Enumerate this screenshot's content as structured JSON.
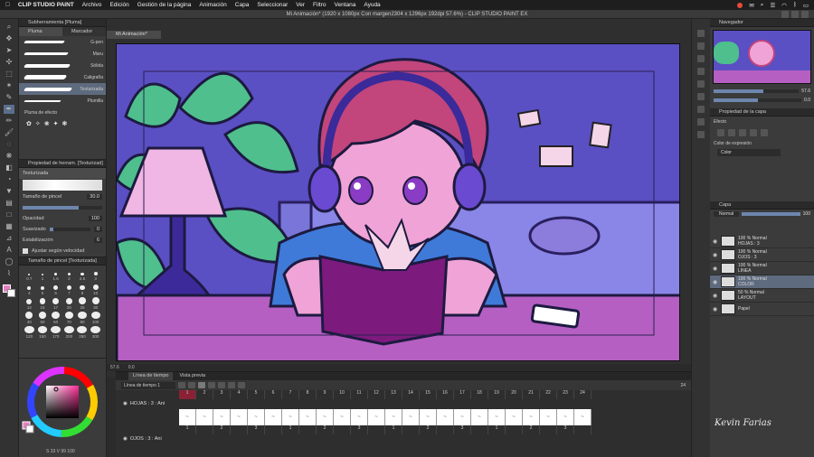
{
  "menubar": {
    "app": "CLIP STUDIO PAINT",
    "items": [
      "Archivo",
      "Edición",
      "Gestión de la página",
      "Animación",
      "Capa",
      "Seleccionar",
      "Ver",
      "Filtro",
      "Ventana",
      "Ayuda"
    ]
  },
  "window": {
    "title": "Mi Animación* (1920 x 1080px Con margen2304 x 1296px 192dpi 57.6%) - CLIP STUDIO PAINT EX",
    "doc_tab": "Mi Animación*"
  },
  "subtool": {
    "panel_title": "Subherramienta [Pluma]",
    "tabs": [
      "Pluma",
      "Marcador"
    ],
    "brushes": [
      {
        "label": "G-pen"
      },
      {
        "label": "Maru"
      },
      {
        "label": "Sólida"
      },
      {
        "label": "Caligrafía"
      },
      {
        "label": "Texturizada"
      },
      {
        "label": "Plumilla"
      }
    ],
    "extra_label": "Pluma de efecto"
  },
  "tool_property": {
    "panel_title": "Propiedad de herram. [Texturizad]",
    "tool_name": "Texturizada",
    "brush_size_label": "Tamaño de pincel",
    "brush_size_value": "30.0",
    "opacity_label": "Opacidad",
    "opacity_value": "100",
    "smoothing_label": "Suavizado",
    "smoothing_value": "0",
    "stabilization_label": "Estabilización",
    "stabilization_value": "6",
    "speed_label": "Ajustar según velocidad"
  },
  "brush_size_panel": {
    "title": "Tamaño de pincel [Texturizada]",
    "sizes": [
      "0.7",
      "1",
      "1.5",
      "2",
      "2.5",
      "3",
      "4",
      "5",
      "6",
      "7",
      "8",
      "10",
      "12",
      "15",
      "17",
      "20",
      "25",
      "30",
      "40",
      "50",
      "60",
      "70",
      "80",
      "100",
      "120",
      "150",
      "170",
      "200",
      "250",
      "300"
    ]
  },
  "color_panel": {
    "hsv_readout": "S 33 V 99 100",
    "main_color": "#e77fc2",
    "sub_color": "#ffffff"
  },
  "canvas_status": {
    "zoom": "57.6",
    "rotation": "0.0"
  },
  "timeline": {
    "tabs": [
      "Línea de tiempo",
      "Vista previa"
    ],
    "timeline_select": "Línea de tiempo 1",
    "frame_numbers": [
      "1",
      "2",
      "3",
      "4",
      "5",
      "6",
      "7",
      "8",
      "9",
      "10",
      "11",
      "12",
      "13",
      "14",
      "15",
      "16",
      "17",
      "18",
      "19",
      "20",
      "21",
      "22",
      "23",
      "24"
    ],
    "end_frame": "24",
    "tracks": [
      {
        "label": "HOJAS : 3 : Ani",
        "cells": [
          "1",
          "",
          "2",
          "",
          "3",
          "",
          "1",
          "",
          "2",
          "",
          "3",
          "",
          "1",
          "",
          "2",
          "",
          "3",
          "",
          "1",
          "",
          "2",
          "",
          "3",
          ""
        ]
      },
      {
        "label": "OJOS : 3 : Ani",
        "cells": []
      }
    ]
  },
  "navigator": {
    "title": "Navegador",
    "zoom": "57.6",
    "angle": "0.0"
  },
  "layer_property": {
    "title": "Propiedad de la capa",
    "effect_label": "Efecto",
    "expression_label": "Color de expresión",
    "expression_value": "Color"
  },
  "layers": {
    "title": "Capa",
    "blend_mode": "Normal",
    "opacity": "100",
    "items": [
      {
        "mode": "100 % Normal",
        "name": "HOJAS : 3",
        "selected": false
      },
      {
        "mode": "100 % Normal",
        "name": "OJOS : 3",
        "selected": false
      },
      {
        "mode": "100 % Normal",
        "name": "LINEA",
        "selected": false
      },
      {
        "mode": "100 % Normal",
        "name": "COLOR",
        "selected": true
      },
      {
        "mode": "50 % Normal",
        "name": "LAYOUT",
        "selected": false
      },
      {
        "mode": "",
        "name": "Papel",
        "selected": false
      }
    ]
  },
  "watermark": "Kevin Farias"
}
